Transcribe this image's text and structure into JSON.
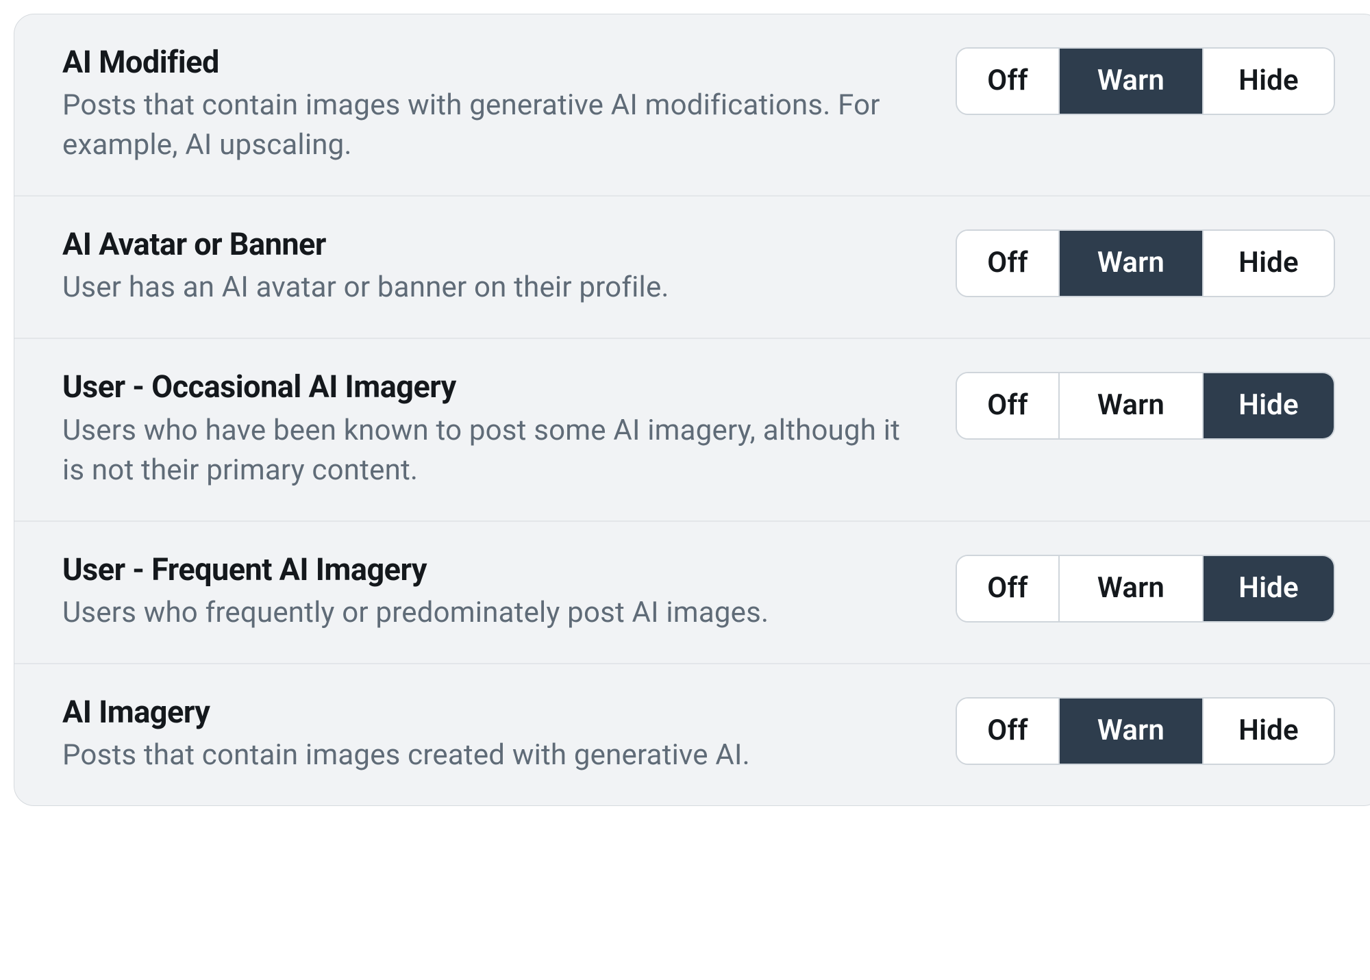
{
  "colors": {
    "panel_bg": "#f1f3f5",
    "selected_bg": "#2e3d4d",
    "text": "#14181c",
    "muted": "#5f6b77"
  },
  "segmented_labels": {
    "off": "Off",
    "warn": "Warn",
    "hide": "Hide"
  },
  "settings": [
    {
      "title": "AI Modified",
      "description": "Posts that contain images with generative AI modifications. For example, AI upscaling.",
      "selected": "warn"
    },
    {
      "title": "AI Avatar or Banner",
      "description": "User has an AI avatar or banner on their profile.",
      "selected": "warn"
    },
    {
      "title": "User - Occasional AI Imagery",
      "description": "Users who have been known to post some AI imagery, although it is not their primary content.",
      "selected": "hide"
    },
    {
      "title": "User - Frequent AI Imagery",
      "description": "Users who frequently or predominately post AI images.",
      "selected": "hide"
    },
    {
      "title": "AI Imagery",
      "description": "Posts that contain images created with generative AI.",
      "selected": "warn"
    }
  ]
}
